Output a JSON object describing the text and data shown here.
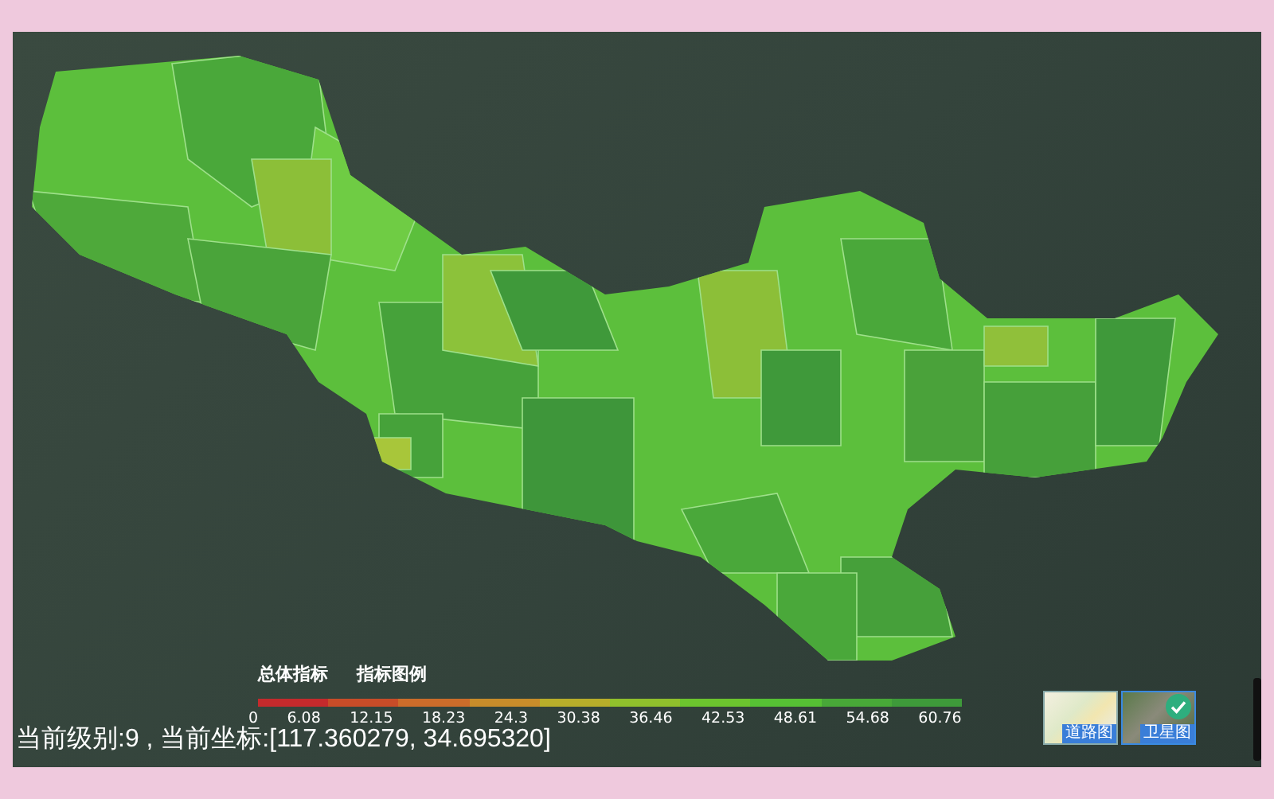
{
  "legend": {
    "titles": [
      "总体指标",
      "指标图例"
    ],
    "segments": [
      {
        "color": "#c42a2c"
      },
      {
        "color": "#c84c28"
      },
      {
        "color": "#cc6c2a"
      },
      {
        "color": "#c88c2a"
      },
      {
        "color": "#b8ae2a"
      },
      {
        "color": "#90c02c"
      },
      {
        "color": "#6cc42e"
      },
      {
        "color": "#56c034"
      },
      {
        "color": "#48a838"
      },
      {
        "color": "#3e9a3a"
      }
    ],
    "ticks": [
      "0",
      "6.08",
      "12.15",
      "18.23",
      "24.3",
      "30.38",
      "36.46",
      "42.53",
      "48.61",
      "54.68",
      "60.76"
    ]
  },
  "status_bar": {
    "text": "当前级别:9 , 当前坐标:[117.360279, 34.695320]"
  },
  "map_types": [
    {
      "label": "道路图",
      "kind": "road",
      "selected": false
    },
    {
      "label": "卫星图",
      "kind": "satellite",
      "selected": true
    }
  ]
}
